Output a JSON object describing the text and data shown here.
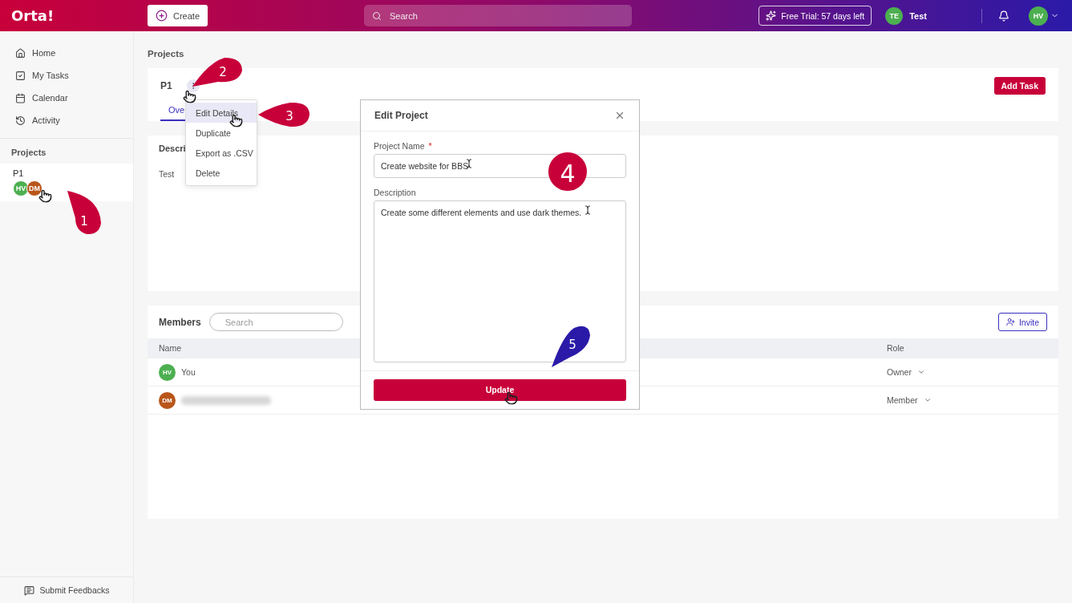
{
  "topbar": {
    "logo": "Orta!",
    "create_button": "Create",
    "search": {
      "placeholder": "Search"
    },
    "trial_badge": "Free Trial: 57 days left",
    "workspace": {
      "initials": "TE",
      "name": "Test",
      "color": "#4caf50"
    },
    "user": {
      "initials": "HV",
      "color": "#4caf50"
    }
  },
  "sidebar": {
    "items": [
      {
        "label": "Home"
      },
      {
        "label": "My Tasks"
      },
      {
        "label": "Calendar"
      },
      {
        "label": "Activity"
      }
    ],
    "projects_heading": "Projects",
    "projects": [
      {
        "name": "P1",
        "selected": true,
        "members": [
          {
            "initials": "HV",
            "color": "#4caf50"
          },
          {
            "initials": "DM",
            "color": "#b8561a"
          }
        ]
      }
    ],
    "footer": "Submit Feedbacks"
  },
  "breadcrumb": "Projects",
  "project": {
    "title": "P1",
    "add_task": "Add Task",
    "tabs": [
      {
        "label": "Ove",
        "selected": true
      }
    ]
  },
  "description_card": {
    "heading": "Descri",
    "text": "Test"
  },
  "menu": {
    "items": [
      {
        "label": "Edit Details",
        "selected": true
      },
      {
        "label": "Duplicate",
        "selected": false
      },
      {
        "label": "Export as .CSV",
        "selected": false
      },
      {
        "label": "Delete",
        "selected": false
      }
    ]
  },
  "members": {
    "heading": "Members",
    "search": {
      "placeholder": "Search"
    },
    "invite": "Invite",
    "columns": [
      "Name",
      "Role"
    ],
    "rows": [
      {
        "initials": "HV",
        "color": "#4caf50",
        "name": "You",
        "name_blurred": false,
        "role": "Owner"
      },
      {
        "initials": "DM",
        "color": "#b8561a",
        "name_blurred": true,
        "role": "Member"
      }
    ]
  },
  "dialog": {
    "title": "Edit Project",
    "required_mark": "*",
    "fields": [
      {
        "label": "Project Name",
        "required": true,
        "value": "Create website for BBS",
        "kind": "input"
      },
      {
        "label": "Description",
        "required": false,
        "value": "Create some different elements and use dark themes.",
        "kind": "textarea"
      }
    ],
    "submit": "Update"
  },
  "annotations": [
    {
      "label": "1",
      "color": "#c8003a"
    },
    {
      "label": "2",
      "color": "#c8003a"
    },
    {
      "label": "3",
      "color": "#c8003a"
    },
    {
      "label": "4",
      "color": "#c8003a"
    },
    {
      "label": "5",
      "color": "#2a1aa8"
    }
  ]
}
